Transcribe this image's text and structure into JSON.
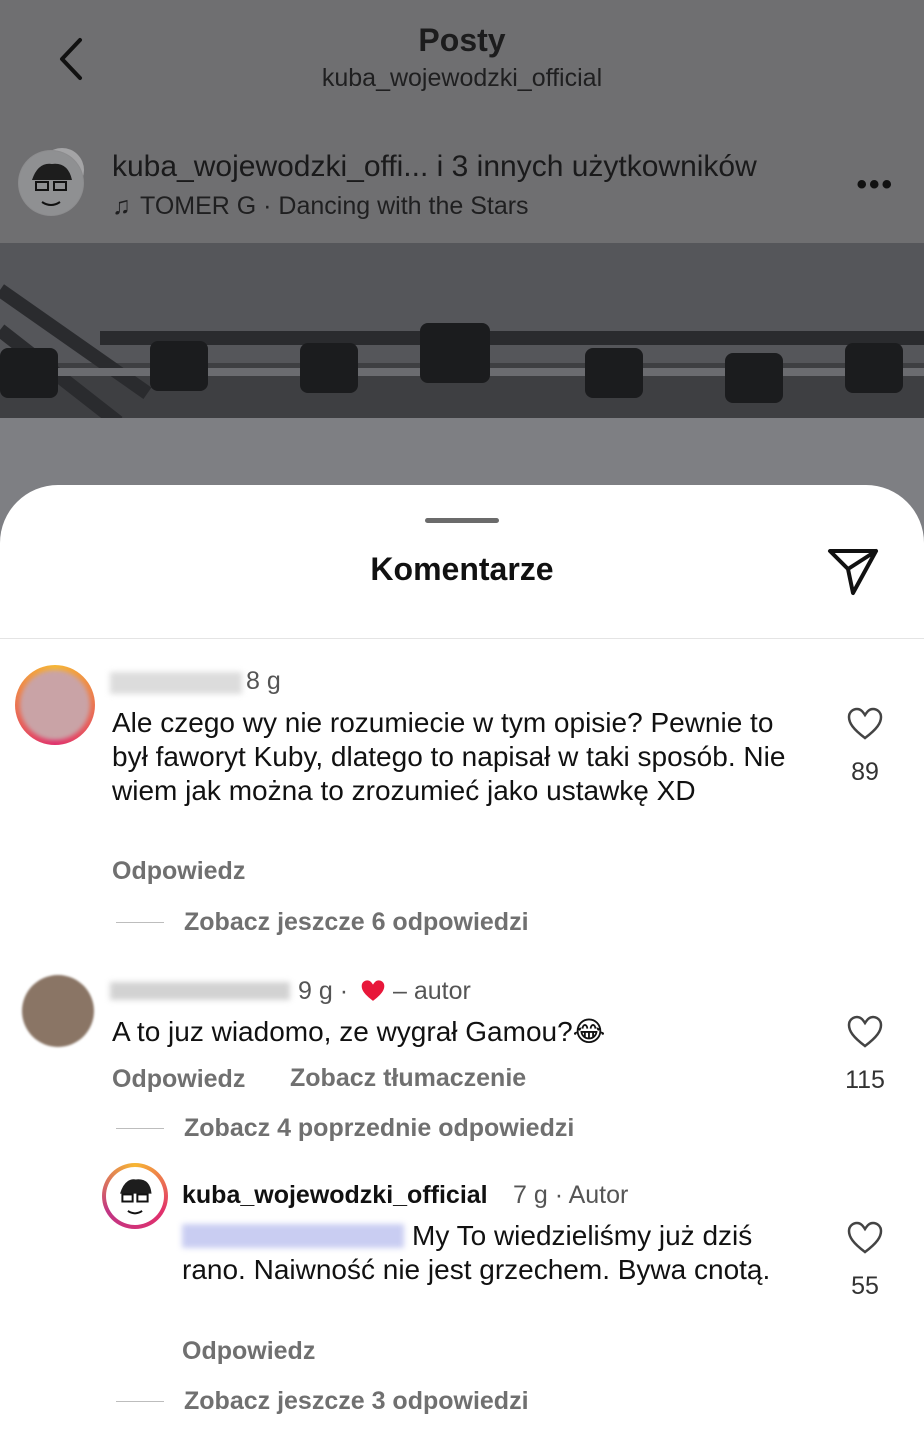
{
  "nav": {
    "title": "Posty",
    "subtitle": "kuba_wojewodzki_official"
  },
  "post": {
    "user": "kuba_wojewodzki_offi... i 3 innych użytkowników",
    "music": "TOMER G · Dancing with the Stars",
    "more_label": "•••"
  },
  "sheet": {
    "title": "Komentarze"
  },
  "comments": [
    {
      "time": "8 g",
      "text": "Ale czego wy nie rozumiecie w tym opisie? Pewnie to był faworyt Kuby, dlatego to napisał w taki sposób. Nie wiem jak można to zrozumieć jako ustawkę XD",
      "reply_label": "Odpowiedz",
      "likes": "89",
      "more_replies": "Zobacz jeszcze 6 odpowiedzi"
    },
    {
      "time": "9 g ·",
      "author_note": "– autor",
      "text": "A to juz wiadomo,  ze wygrał Gamou?😂",
      "reply_label": "Odpowiedz",
      "translate_label": "Zobacz tłumaczenie",
      "likes": "115",
      "previous_replies": "Zobacz 4 poprzednie odpowiedzi"
    },
    {
      "user": "kuba_wojewodzki_official",
      "time": "7 g · Autor",
      "text": "My To wiedzieliśmy już dziś rano. Naiwność nie jest grzechem. Bywa cnotą.",
      "reply_label": "Odpowiedz",
      "likes": "55",
      "more_replies": "Zobacz jeszcze 3 odpowiedzi"
    }
  ],
  "colors": {
    "heart_red": "#e8173a",
    "story_ring": "#f0831d",
    "background_dim": "#6f6f71"
  }
}
